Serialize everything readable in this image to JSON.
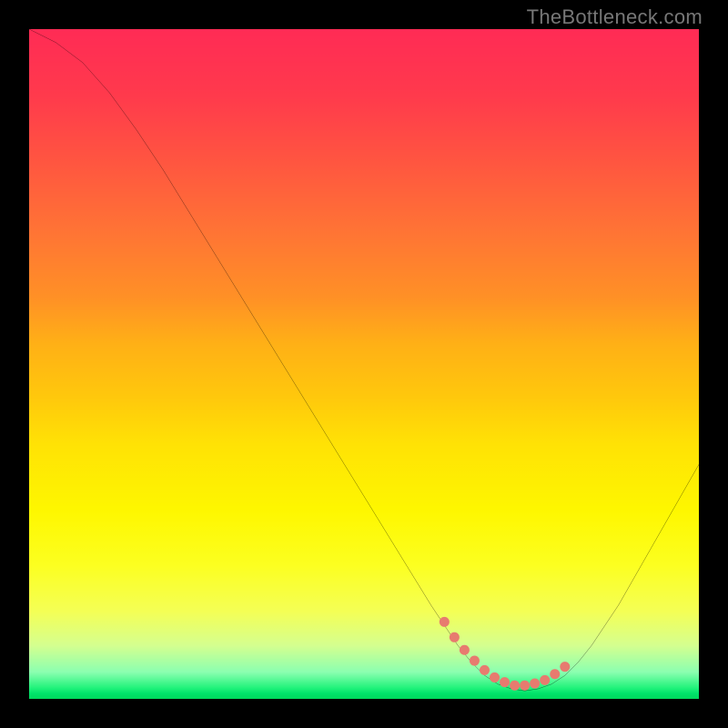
{
  "watermark": "TheBottleneck.com",
  "chart_data": {
    "type": "line",
    "title": "",
    "xlabel": "",
    "ylabel": "",
    "xlim": [
      0,
      100
    ],
    "ylim": [
      0,
      100
    ],
    "series": [
      {
        "name": "curve",
        "x": [
          0,
          4,
          8,
          12,
          16,
          20,
          24,
          28,
          32,
          36,
          40,
          44,
          48,
          52,
          56,
          60,
          62,
          64,
          66,
          68,
          70,
          72,
          74,
          76,
          78,
          80,
          82,
          84,
          86,
          88,
          90,
          92,
          94,
          96,
          98,
          100
        ],
        "y": [
          100,
          98,
          95,
          90.5,
          85,
          79,
          72.5,
          66,
          59.5,
          53,
          46.5,
          40,
          33.5,
          27,
          20.5,
          14,
          11,
          8,
          5.5,
          3.5,
          2.2,
          1.5,
          1.2,
          1.5,
          2.2,
          3.5,
          5.5,
          8,
          11,
          14,
          17.5,
          21,
          24.5,
          28,
          31.5,
          35
        ]
      }
    ],
    "markers": {
      "name": "markers",
      "x": [
        62,
        63.5,
        65,
        66.5,
        68,
        69.5,
        71,
        72.5,
        74,
        75.5,
        77,
        78.5,
        80
      ],
      "y": [
        11.5,
        9.2,
        7.3,
        5.7,
        4.3,
        3.2,
        2.5,
        2.0,
        2.0,
        2.3,
        2.8,
        3.7,
        4.8
      ],
      "marker_color": "#e77b6f"
    },
    "gradient": {
      "top_color": "#FF2B55",
      "mid_colors": [
        "#FFB016",
        "#FEF700"
      ],
      "bottom_color": "#00D85B"
    }
  }
}
